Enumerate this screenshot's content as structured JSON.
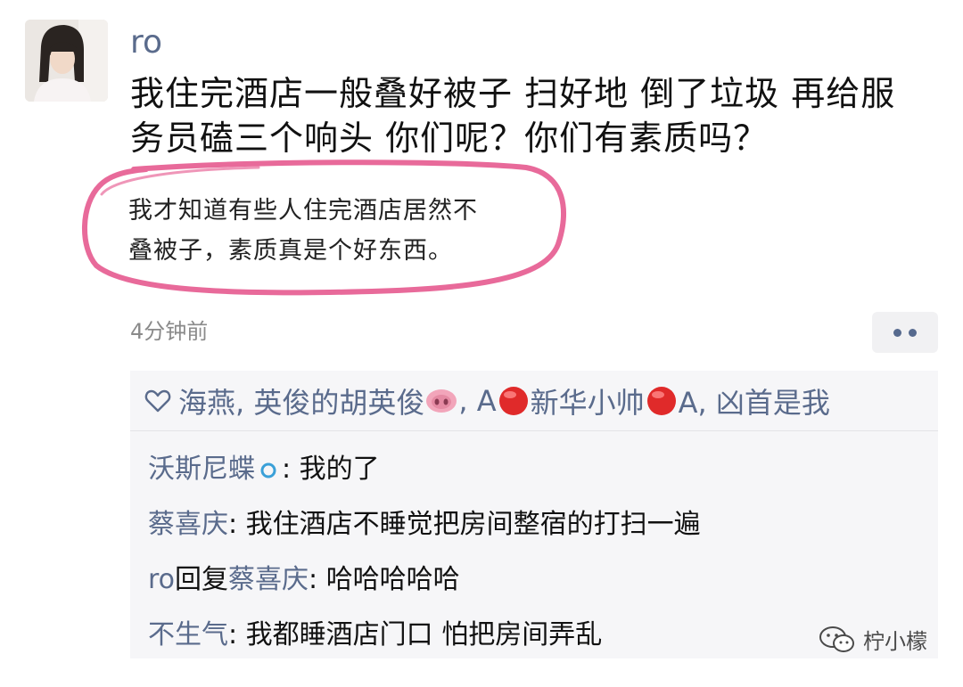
{
  "post": {
    "username": "ro",
    "text_line1": "我住完酒店一般叠好被子 扫好地 倒了垃圾 再给服",
    "text_line2": "务员磕三个响头 你们呢？你们有素质吗？",
    "quote_line1": "我才知道有些人住完酒店居然不",
    "quote_line2": "叠被子，素质真是个好东西。",
    "timestamp": "4分钟前"
  },
  "likes": {
    "names_part1": "海燕, 英俊的胡英俊",
    "names_part2": ", A",
    "names_part3": "新华小帅",
    "names_part4": "A, 凶首是我"
  },
  "comments": [
    {
      "name": "沃斯尼蝶",
      "sep": ": ",
      "text": "我的了"
    },
    {
      "name": "蔡喜庆",
      "sep": ": ",
      "text": "我住酒店不睡觉把房间整宿的打扫一遍"
    },
    {
      "name": "ro",
      "reply_word": "回复",
      "reply_to": "蔡喜庆",
      "sep": ": ",
      "text": "哈哈哈哈哈"
    },
    {
      "name": "不生气",
      "sep": ": ",
      "text": "我都睡酒店门口 怕把房间弄乱"
    }
  ],
  "watermark": "柠小檬",
  "colors": {
    "name_blue": "#5a6b8c",
    "highlight_circle": "#e86a9a",
    "comment_bg": "#f6f6f8"
  }
}
